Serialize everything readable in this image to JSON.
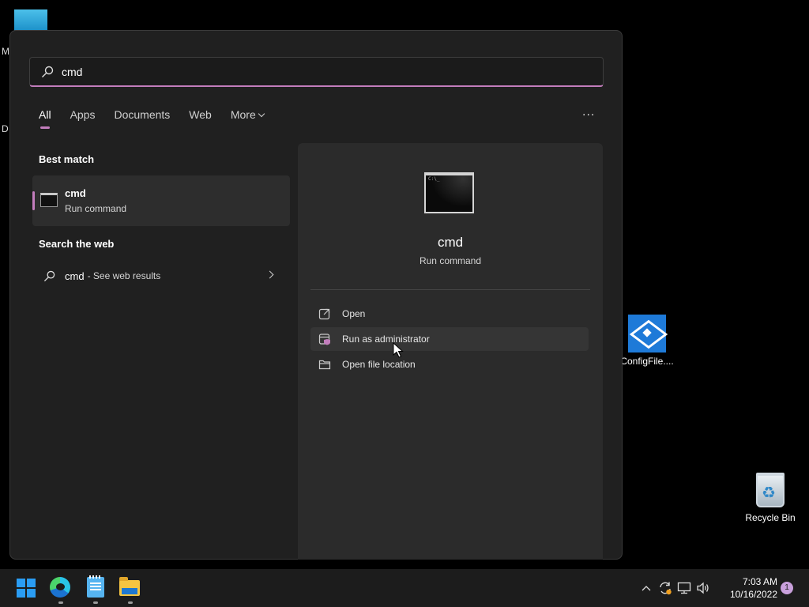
{
  "desktop": {
    "edge_letters": [
      "M",
      "D"
    ],
    "icons": [
      {
        "label": "ConfigFile...."
      },
      {
        "label": "Recycle Bin"
      }
    ]
  },
  "start_menu": {
    "search": {
      "value": "cmd"
    },
    "tabs": [
      {
        "label": "All",
        "active": true
      },
      {
        "label": "Apps"
      },
      {
        "label": "Documents"
      },
      {
        "label": "Web"
      },
      {
        "label": "More"
      }
    ],
    "more_options": "...",
    "best_match": {
      "heading": "Best match",
      "name": "cmd",
      "type": "Run command"
    },
    "web_search": {
      "heading": "Search the web",
      "query": "cmd",
      "suffix": "- See web results"
    },
    "detail": {
      "name": "cmd",
      "type": "Run command",
      "actions": [
        {
          "label": "Open",
          "icon": "open-icon"
        },
        {
          "label": "Run as administrator",
          "icon": "admin-shield-icon"
        },
        {
          "label": "Open file location",
          "icon": "folder-icon"
        }
      ]
    }
  },
  "taskbar": {
    "apps": [
      "start",
      "edge",
      "notepad",
      "file-explorer"
    ],
    "tray": [
      "chevron-up-icon",
      "sync-icon",
      "network-icon",
      "volume-icon"
    ],
    "clock": {
      "time": "7:03 AM",
      "date": "10/16/2022"
    },
    "notifications": "1"
  },
  "colors": {
    "accent": "#c27dbc",
    "panel": "#202020",
    "taskbar": "#1c1c1c"
  }
}
